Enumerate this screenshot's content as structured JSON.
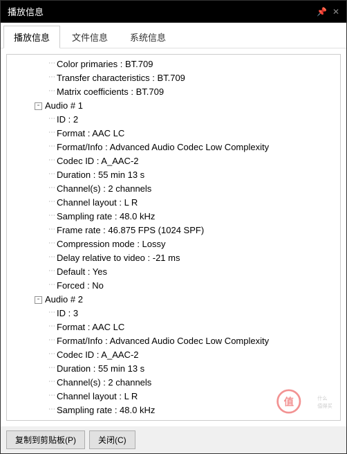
{
  "window": {
    "title": "播放信息"
  },
  "tabs": {
    "t0": "播放信息",
    "t1": "文件信息",
    "t2": "系统信息"
  },
  "tree": {
    "v0": "Color primaries : BT.709",
    "v1": "Transfer characteristics : BT.709",
    "v2": "Matrix coefficients : BT.709",
    "a1": "Audio # 1",
    "a1_id": "ID : 2",
    "a1_fmt": "Format : AAC LC",
    "a1_info": "Format/Info : Advanced Audio Codec Low Complexity",
    "a1_codec": "Codec ID : A_AAC-2",
    "a1_dur": "Duration : 55 min 13 s",
    "a1_ch": "Channel(s) : 2 channels",
    "a1_lay": "Channel layout : L R",
    "a1_sr": "Sampling rate : 48.0 kHz",
    "a1_fr": "Frame rate : 46.875 FPS (1024 SPF)",
    "a1_cm": "Compression mode : Lossy",
    "a1_del": "Delay relative to video : -21 ms",
    "a1_def": "Default : Yes",
    "a1_for": "Forced : No",
    "a2": "Audio # 2",
    "a2_id": "ID : 3",
    "a2_fmt": "Format : AAC LC",
    "a2_info": "Format/Info : Advanced Audio Codec Low Complexity",
    "a2_codec": "Codec ID : A_AAC-2",
    "a2_dur": "Duration : 55 min 13 s",
    "a2_ch": "Channel(s) : 2 channels",
    "a2_lay": "Channel layout : L R",
    "a2_sr": "Sampling rate : 48.0 kHz"
  },
  "buttons": {
    "copy": "复制到剪贴板(P)",
    "close": "关闭(C)"
  },
  "watermark": "值 什么值得买"
}
